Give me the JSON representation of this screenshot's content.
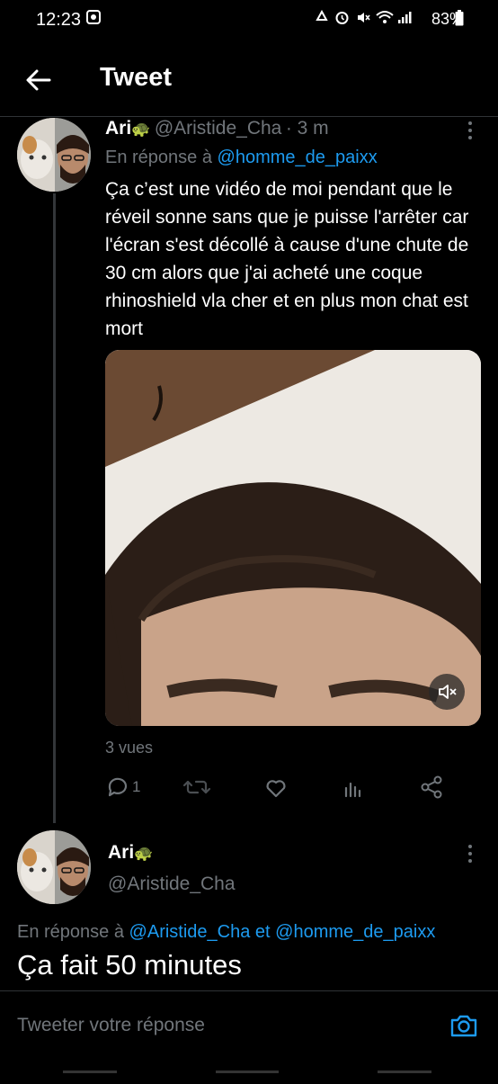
{
  "status_bar": {
    "time": "12:23",
    "battery": "83%",
    "icons": [
      "photo-icon",
      "recycle-icon",
      "alarm-icon",
      "mute-icon",
      "wifi-icon",
      "signal-icon",
      "battery-icon"
    ]
  },
  "header": {
    "title": "Tweet",
    "back_icon": "arrow-left-icon"
  },
  "tweet1": {
    "name": "Ari",
    "emoji": "🐢",
    "handle": "@Aristide_Cha",
    "time": "· 3 m",
    "reply_prefix": "En réponse à",
    "reply_to": "@homme_de_paixx",
    "text": "Ça c’est une vidéo de moi pendant que le réveil sonne sans que je puisse l'arrêter car l'écran s'est décollé à cause d'une chute de 30 cm alors que j'ai acheté une coque rhinoshield vla cher et en plus mon chat est mort",
    "views": "3 vues",
    "reply_count": "1"
  },
  "tweet2": {
    "name": "Ari",
    "emoji": "🐢",
    "handle": "@Aristide_Cha",
    "reply_prefix": "En réponse à",
    "reply_to_1": "@Aristide_Cha",
    "reply_and": "et",
    "reply_to_2": "@homme_de_paixx",
    "text": "Ça fait 50 minutes"
  },
  "reply_bar": {
    "placeholder": "Tweeter votre réponse"
  },
  "colors": {
    "accent": "#1d9bf0",
    "background": "#000000",
    "muted": "#71767b",
    "text": "#e7e9ea"
  }
}
